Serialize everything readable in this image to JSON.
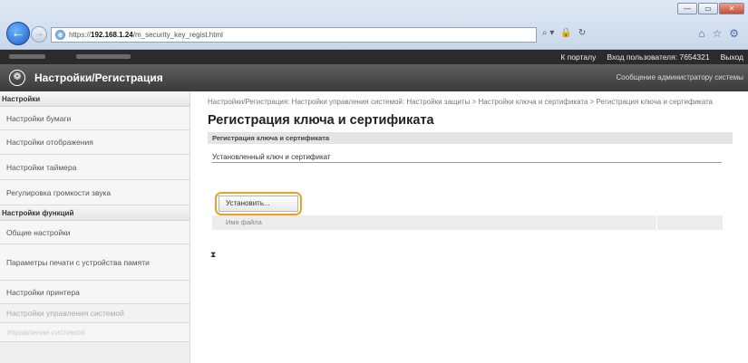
{
  "browser": {
    "url_prefix": "https://",
    "url_host": "192.168.1.24",
    "url_path": "/m_security_key_regist.html",
    "win_minimize": "—",
    "win_maximize": "▭",
    "win_close": "✕",
    "addr_tools": [
      "⌕ ▾",
      "🔒",
      "↻"
    ],
    "right_tools": [
      "⌂",
      "☆",
      "⚙"
    ]
  },
  "topbar": {
    "portal_link": "К порталу",
    "user_label": "Вход пользователя: 7654321",
    "logout_link": "Выход"
  },
  "header": {
    "title": "Настройки/Регистрация",
    "admin_message": "Сообщение администратору системы"
  },
  "sidebar": {
    "section1": "Настройки",
    "items1": [
      "Настройки бумаги",
      "Настройки отображения",
      "Настройки таймера",
      "Регулировка громкости звука"
    ],
    "section2": "Настройки функций",
    "items2": [
      "Общие настройки",
      "Параметры печати с устройства памяти",
      "Настройки принтера"
    ],
    "item_sysmgmt": "Настройки управления системой",
    "item_faded": "Управление системой"
  },
  "main": {
    "breadcrumb": "Настройки/Регистрация: Настройки управления системой: Настройки защиты > Настройки ключа и сертификата > Регистрация ключа и сертификата",
    "title": "Регистрация ключа и сертификата",
    "section": "Регистрация ключа и сертификата",
    "subheading": "Установленный ключ и сертификат",
    "install_button": "Установить...",
    "file_name_header": "Имя файла",
    "to_top": "⧗"
  }
}
